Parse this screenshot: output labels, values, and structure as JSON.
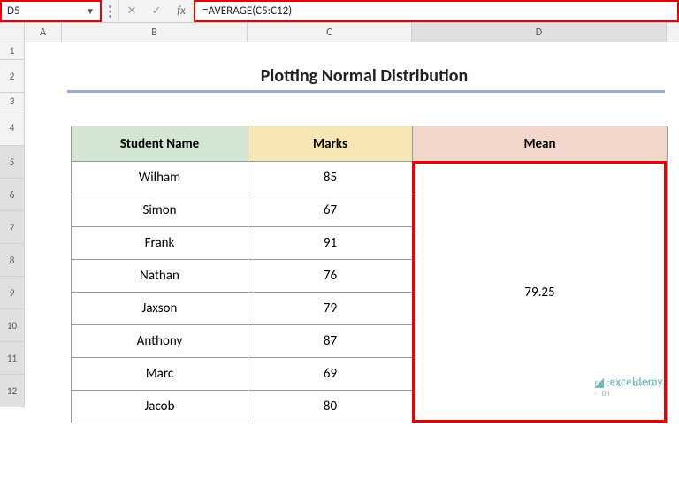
{
  "formula_bar": {
    "cell_ref": "D5",
    "fx_label": "fx",
    "formula": "=AVERAGE(C5:C12)"
  },
  "columns": {
    "A": "A",
    "B": "B",
    "C": "C",
    "D": "D"
  },
  "rows": [
    "1",
    "2",
    "3",
    "4",
    "5",
    "6",
    "7",
    "8",
    "9",
    "10",
    "11",
    "12"
  ],
  "title": "Plotting Normal Distribution",
  "headers": {
    "name": "Student Name",
    "marks": "Marks",
    "mean": "Mean"
  },
  "students": [
    {
      "name": "Wilham",
      "marks": 85
    },
    {
      "name": "Simon",
      "marks": 67
    },
    {
      "name": "Frank",
      "marks": 91
    },
    {
      "name": "Nathan",
      "marks": 76
    },
    {
      "name": "Jaxson",
      "marks": 79
    },
    {
      "name": "Anthony",
      "marks": 87
    },
    {
      "name": "Marc",
      "marks": 69
    },
    {
      "name": "Jacob",
      "marks": 80
    }
  ],
  "mean_value": "79.25",
  "watermark": {
    "brand": "exceldemy",
    "tag": "EXCEL · DATA · BI"
  },
  "chart_data": {
    "type": "table",
    "title": "Plotting Normal Distribution",
    "columns": [
      "Student Name",
      "Marks",
      "Mean"
    ],
    "rows": [
      [
        "Wilham",
        85,
        79.25
      ],
      [
        "Simon",
        67,
        79.25
      ],
      [
        "Frank",
        91,
        79.25
      ],
      [
        "Nathan",
        76,
        79.25
      ],
      [
        "Jaxson",
        79,
        79.25
      ],
      [
        "Anthony",
        87,
        79.25
      ],
      [
        "Marc",
        69,
        79.25
      ],
      [
        "Jacob",
        80,
        79.25
      ]
    ],
    "annotations": [
      "D5 = AVERAGE(C5:C12)"
    ]
  }
}
